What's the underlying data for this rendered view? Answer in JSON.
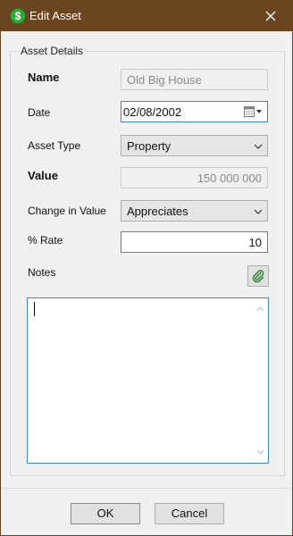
{
  "window": {
    "title": "Edit Asset",
    "icon": "dollar-coin-icon",
    "icon_glyph": "$",
    "close_icon": "close-icon"
  },
  "group": {
    "legend": "Asset Details"
  },
  "fields": {
    "name": {
      "label": "Name",
      "value": "Old Big House"
    },
    "date": {
      "label": "Date",
      "value": "02/08/2002"
    },
    "asset_type": {
      "label": "Asset Type",
      "value": "Property"
    },
    "value": {
      "label": "Value",
      "value": "150 000 000"
    },
    "change": {
      "label": "Change in Value",
      "value": "Appreciates"
    },
    "rate": {
      "label": "% Rate",
      "value": "10"
    },
    "notes": {
      "label": "Notes",
      "value": ""
    }
  },
  "buttons": {
    "ok": "OK",
    "cancel": "Cancel"
  },
  "colors": {
    "titlebar": "#6b4420",
    "focus_border": "#3b86c9",
    "icon_green": "#32a83a",
    "attach_green": "#3a8a3a"
  }
}
